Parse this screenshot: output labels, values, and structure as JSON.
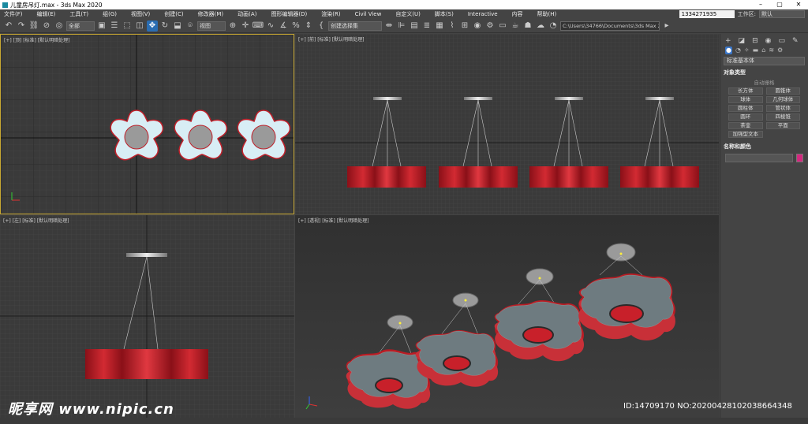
{
  "window": {
    "title": "儿童房吊灯.max - 3ds Max 2020",
    "controls": [
      "–",
      "▢",
      "✕"
    ]
  },
  "menu": {
    "items": [
      "文件(F)",
      "编辑(E)",
      "工具(T)",
      "组(G)",
      "视图(V)",
      "创建(C)",
      "修改器(M)",
      "动画(A)",
      "图形编辑器(D)",
      "渲染(R)",
      "Civil View",
      "自定义(U)",
      "脚本(S)",
      "Interactive",
      "内容",
      "帮助(H)"
    ],
    "user": "1334271935",
    "workspace_label": "工作区:",
    "workspace_value": "默认"
  },
  "toolbar": {
    "filter_value": "全部",
    "coord_value": "视图",
    "selection_set_placeholder": "创建选择集",
    "project_path": "C:\\Users\\34766\\Documents\\3ds Max 2020"
  },
  "viewports": {
    "top": "[+] [顶] [标准] [默认明暗处理]",
    "front": "[+] [前] [标准] [默认明暗处理]",
    "left": "[+] [左] [标准] [默认明暗处理]",
    "perspective": "[+] [透视] [标准] [默认明暗处理]"
  },
  "command_panel": {
    "dropdown_value": "标准基本体",
    "object_type_header": "对象类型",
    "autogrid_label": "自动栅格",
    "primitives": [
      "长方体",
      "圆锥体",
      "球体",
      "几何球体",
      "圆柱体",
      "管状体",
      "圆环",
      "四棱锥",
      "茶壶",
      "平面",
      "加强型文本"
    ],
    "name_color_header": "名称和颜色"
  },
  "watermark": {
    "logo": "昵享网 www.nipic.cn",
    "id_text": "ID:14709170 NO:20200428102038664348"
  },
  "colors": {
    "accent": "#2a6db2",
    "lamp_red": "#c0202a",
    "flower_fill": "#d8eef5",
    "object_color": "#d4287f"
  }
}
